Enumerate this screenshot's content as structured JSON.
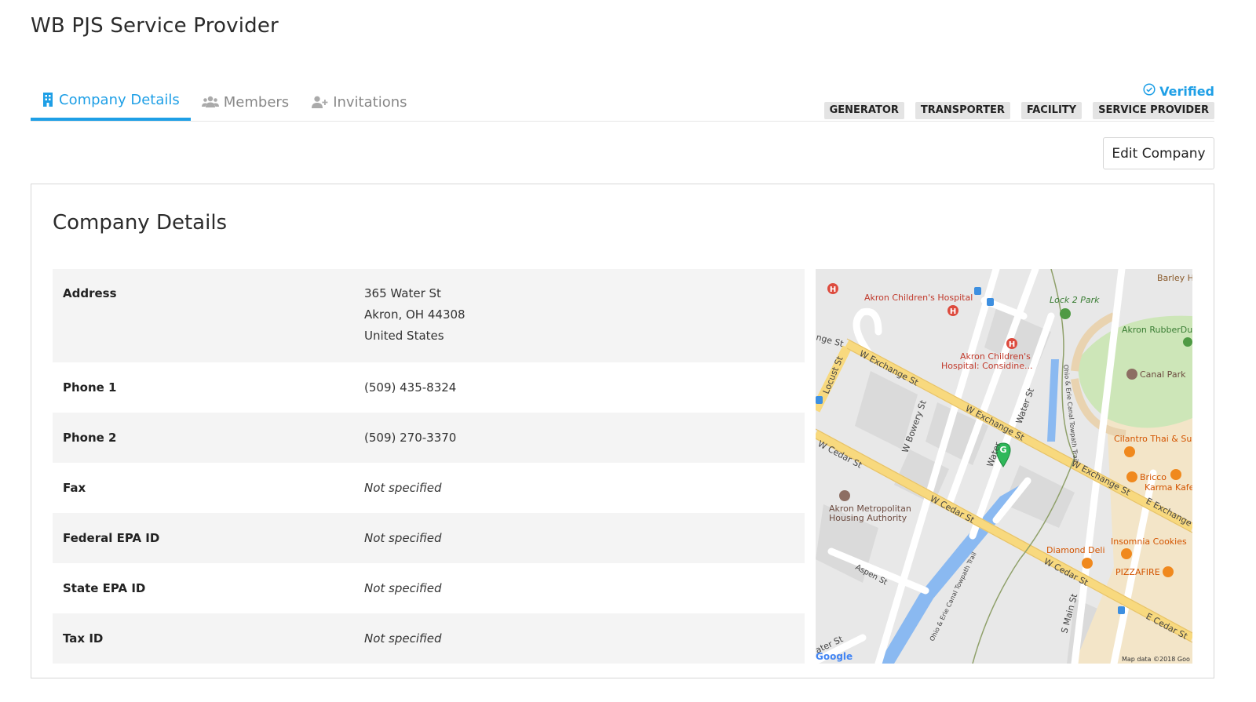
{
  "page": {
    "title": "WB PJS Service Provider"
  },
  "tabs": [
    {
      "label": "Company Details",
      "icon": "building-icon",
      "active": true
    },
    {
      "label": "Members",
      "icon": "users-icon",
      "active": false
    },
    {
      "label": "Invitations",
      "icon": "user-plus-icon",
      "active": false
    }
  ],
  "status": {
    "verified_label": "Verified",
    "verified_icon": "check-circle-icon"
  },
  "roles": [
    "GENERATOR",
    "TRANSPORTER",
    "FACILITY",
    "SERVICE PROVIDER"
  ],
  "actions": {
    "edit_label": "Edit Company"
  },
  "card": {
    "title": "Company Details"
  },
  "details": {
    "address": {
      "label": "Address",
      "line1": "365 Water St",
      "line2": "Akron, OH 44308",
      "line3": "United States"
    },
    "phone1": {
      "label": "Phone 1",
      "value": "(509) 435-8324"
    },
    "phone2": {
      "label": "Phone 2",
      "value": "(509) 270-3370"
    },
    "fax": {
      "label": "Fax",
      "value": "Not specified"
    },
    "federal_epa": {
      "label": "Federal EPA ID",
      "value": "Not specified"
    },
    "state_epa": {
      "label": "State EPA ID",
      "value": "Not specified"
    },
    "tax_id": {
      "label": "Tax ID",
      "value": "Not specified"
    }
  },
  "map": {
    "streets": {
      "w_exchange_1": "W Exchange St",
      "w_exchange_2": "W Exchange St",
      "w_exchange_3": "W Exchange St",
      "e_exchange": "E Exchange",
      "w_cedar_1": "W Cedar St",
      "w_cedar_2": "W Cedar St",
      "w_cedar_3": "W Cedar St",
      "e_cedar": "E Cedar St",
      "locust": "Locust St",
      "w_bowery": "W Bowery St",
      "water_1": "Water St",
      "water_2": "Water",
      "water_3": "ater St",
      "aspen": "Aspen St",
      "s_main": "S Main St",
      "nge": "nge St",
      "towpath_1": "Ohio & Erie Canal Towpath Trail",
      "towpath_2": "Ohio & Erie Canal Towpath Trail"
    },
    "places": {
      "hospital": "Akron Children's Hospital",
      "hospital_2a": "Akron Children's",
      "hospital_2b": "Hospital: Considine...",
      "lock2": "Lock 2 Park",
      "rubberduck": "Akron RubberDuc",
      "barley": "Barley H",
      "canal_park": "Canal Park",
      "cilantro": "Cilantro Thai & Sus",
      "bricco": "Bricco",
      "karma": "Karma Kafe",
      "housing_1": "Akron Metropolitan",
      "housing_2": "Housing Authority",
      "diamond": "Diamond Deli",
      "insomnia": "Insomnia Cookies",
      "pizzafire": "PIZZAFIRE"
    },
    "marker_letter": "G",
    "logo": "Google",
    "attribution": "Map data ©2018 Goo"
  }
}
